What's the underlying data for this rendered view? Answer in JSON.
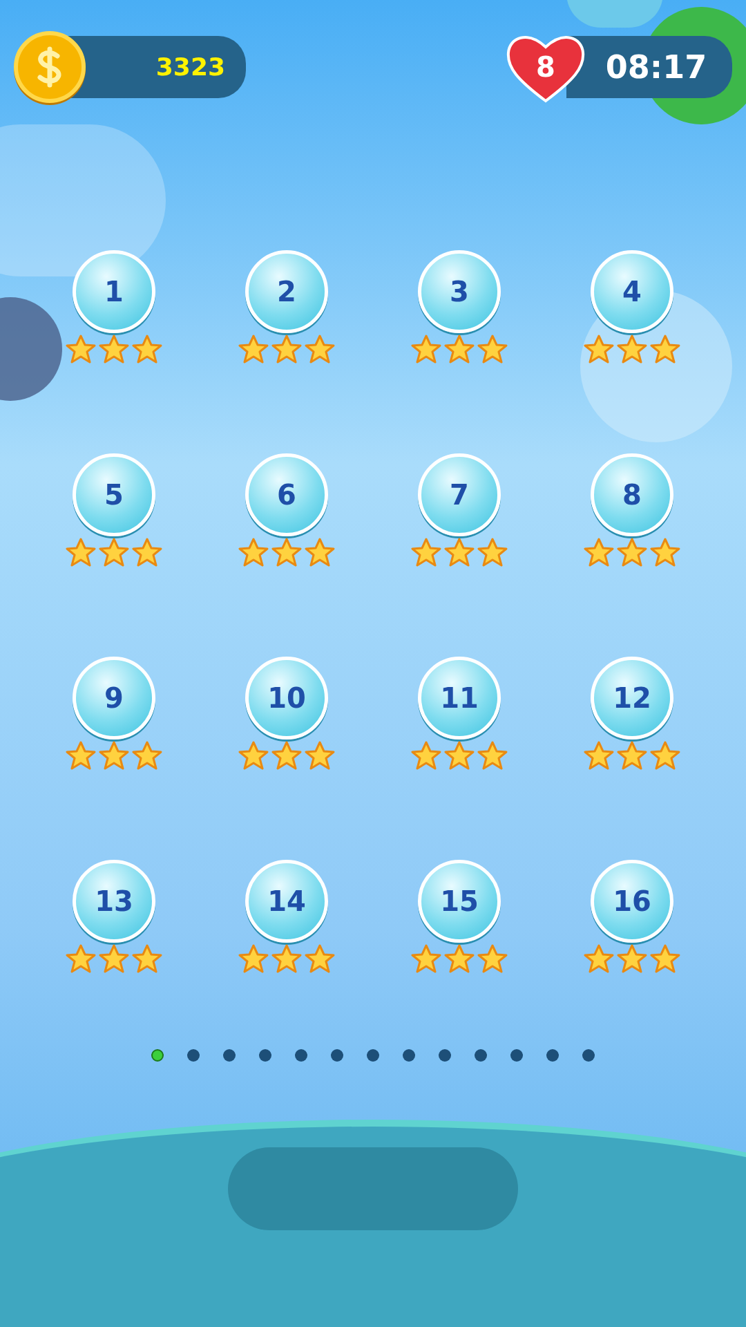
{
  "coins": "3323",
  "lives": {
    "count": "8",
    "timer": "08:17"
  },
  "levels": [
    {
      "number": "1",
      "stars": 3
    },
    {
      "number": "2",
      "stars": 3
    },
    {
      "number": "3",
      "stars": 3
    },
    {
      "number": "4",
      "stars": 3
    },
    {
      "number": "5",
      "stars": 3
    },
    {
      "number": "6",
      "stars": 3
    },
    {
      "number": "7",
      "stars": 3
    },
    {
      "number": "8",
      "stars": 3
    },
    {
      "number": "9",
      "stars": 3
    },
    {
      "number": "10",
      "stars": 3
    },
    {
      "number": "11",
      "stars": 3
    },
    {
      "number": "12",
      "stars": 3
    },
    {
      "number": "13",
      "stars": 3
    },
    {
      "number": "14",
      "stars": 3
    },
    {
      "number": "15",
      "stars": 3
    },
    {
      "number": "16",
      "stars": 3
    }
  ],
  "pages": [
    {
      "selected": true
    },
    {
      "selected": false
    },
    {
      "selected": false
    },
    {
      "selected": false
    },
    {
      "selected": false
    },
    {
      "selected": false
    },
    {
      "selected": false
    },
    {
      "selected": false
    },
    {
      "selected": false
    },
    {
      "selected": false
    },
    {
      "selected": false
    },
    {
      "selected": false
    },
    {
      "selected": false
    }
  ]
}
